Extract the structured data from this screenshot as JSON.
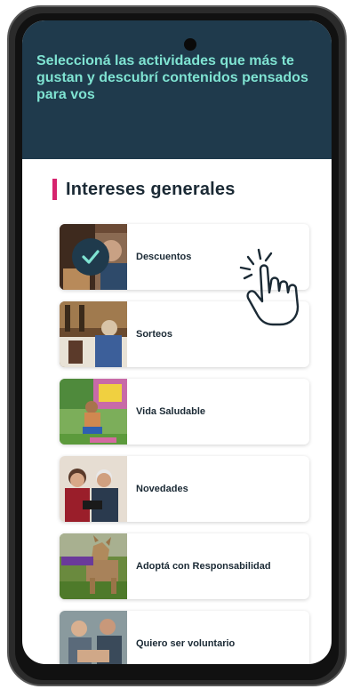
{
  "header": {
    "text": "Seleccioná las actividades que más te gustan y descubrí contenidos pensados para vos"
  },
  "section": {
    "title": "Intereses generales"
  },
  "cards": [
    {
      "label": "Descuentos",
      "selected": true,
      "icon": "check-icon"
    },
    {
      "label": "Sorteos",
      "selected": false
    },
    {
      "label": "Vida Saludable",
      "selected": false
    },
    {
      "label": "Novedades",
      "selected": false
    },
    {
      "label": "Adoptá con Responsabilidad",
      "selected": false
    },
    {
      "label": "Quiero ser voluntario",
      "selected": false
    }
  ],
  "colors": {
    "header_bg": "#1f3a4c",
    "header_text": "#7fe3d2",
    "accent": "#d6246e"
  }
}
